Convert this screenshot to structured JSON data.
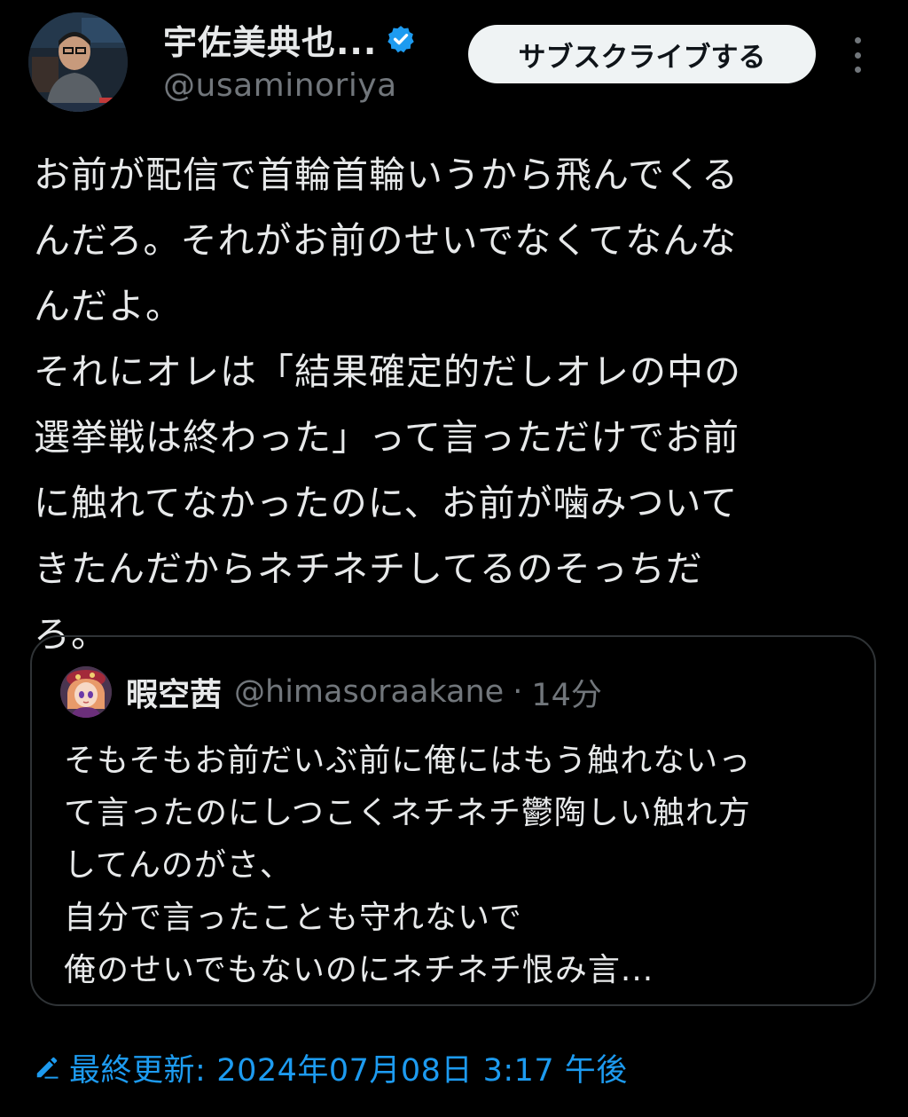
{
  "author": {
    "display_name": "宇佐美典也...",
    "handle": "@usaminoriya",
    "avatar_icon": "user-photo-avatar",
    "verified_icon": "verified-badge-icon"
  },
  "actions": {
    "subscribe_label": "サブスクライブする",
    "more_icon": "more-vertical-icon"
  },
  "tweet": {
    "lines": [
      "お前が配信で首輪首輪いうから飛んでくる",
      "んだろ。それがお前のせいでなくてなんな",
      "んだよ。",
      "それにオレは「結果確定的だしオレの中の",
      "選挙戦は終わった」って言っただけでお前",
      "に触れてなかったのに、お前が噛みついて",
      "きたんだからネチネチしてるのそっちだ",
      "ろ。"
    ]
  },
  "quote": {
    "display_name": "暇空茜",
    "handle": "@himasoraakane",
    "separator": "·",
    "time": "14分",
    "avatar_icon": "anime-character-avatar",
    "lines": [
      "そもそもお前だいぶ前に俺にはもう触れないっ",
      "て言ったのにしつこくネチネチ鬱陶しい触れ方",
      "してんのがさ、",
      "自分で言ったことも守れないで",
      "俺のせいでもないのにネチネチ恨み言..."
    ]
  },
  "edit_info": {
    "label": "最終更新:",
    "date": "2024年07月08日 3:17 午後",
    "icon": "pencil-icon"
  },
  "colors": {
    "background": "#000000",
    "text_primary": "#e7e9ea",
    "text_secondary": "#71767b",
    "accent": "#1d9bf0",
    "border": "#2f3336",
    "button_bg": "#eff3f4"
  }
}
